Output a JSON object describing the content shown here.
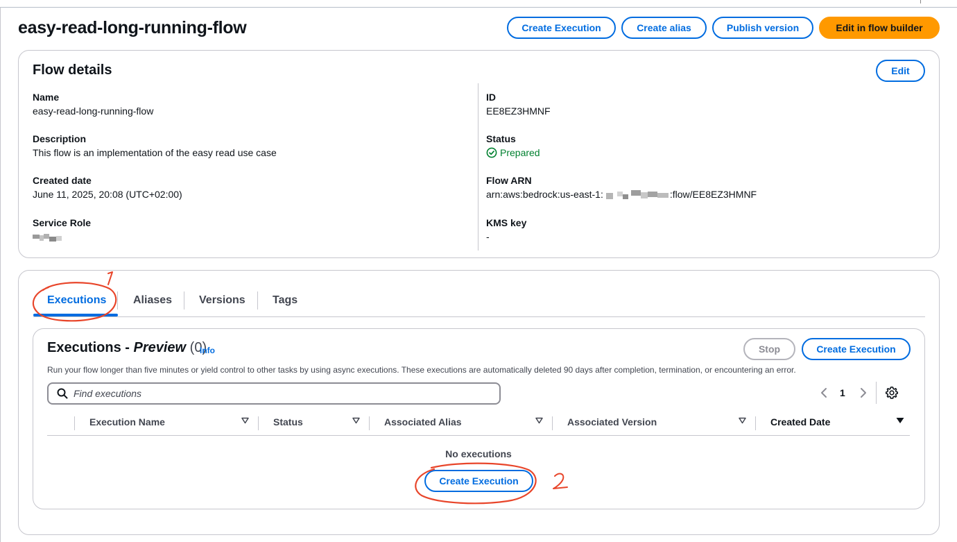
{
  "page": {
    "title": "easy-read-long-running-flow"
  },
  "header_actions": {
    "create_execution": "Create Execution",
    "create_alias": "Create alias",
    "publish_version": "Publish version",
    "edit_in_flow_builder": "Edit in flow builder"
  },
  "flow_details": {
    "title": "Flow details",
    "edit_label": "Edit",
    "name_label": "Name",
    "name_value": "easy-read-long-running-flow",
    "description_label": "Description",
    "description_value": "This flow is an implementation of the easy read use case",
    "created_label": "Created date",
    "created_value": "June 11, 2025, 20:08 (UTC+02:00)",
    "service_role_label": "Service Role",
    "id_label": "ID",
    "id_value": "EE8EZ3HMNF",
    "status_label": "Status",
    "status_value": "Prepared",
    "arn_label": "Flow ARN",
    "arn_prefix": "arn:aws:bedrock:us-east-1:",
    "arn_suffix": ":flow/EE8EZ3HMNF",
    "kms_label": "KMS key",
    "kms_value": "-"
  },
  "tabs": [
    "Executions",
    "Aliases",
    "Versions",
    "Tags"
  ],
  "executions": {
    "title_prefix": "Executions - ",
    "title_italic": "Preview",
    "count": "(0)",
    "info": "Info",
    "description": "Run your flow longer than five minutes or yield control to other tasks by using async executions. These executions are automatically deleted 90 days after completion, termination, or encountering an error.",
    "stop_label": "Stop",
    "create_label": "Create Execution",
    "search_placeholder": "Find executions",
    "page_number": "1",
    "columns": [
      "Execution Name",
      "Status",
      "Associated Alias",
      "Associated Version",
      "Created Date"
    ],
    "empty_text": "No executions",
    "empty_create_label": "Create Execution"
  },
  "annotations": {
    "one": "1",
    "two": "2"
  },
  "colors": {
    "accent": "#006ce0",
    "primary": "#ff9900",
    "success": "#00802f",
    "annotation": "#e8452a"
  },
  "icons": [
    "search-icon",
    "status-success-icon",
    "chevron-left-icon",
    "chevron-right-icon",
    "settings-gear-icon",
    "sort-caret-icon"
  ]
}
